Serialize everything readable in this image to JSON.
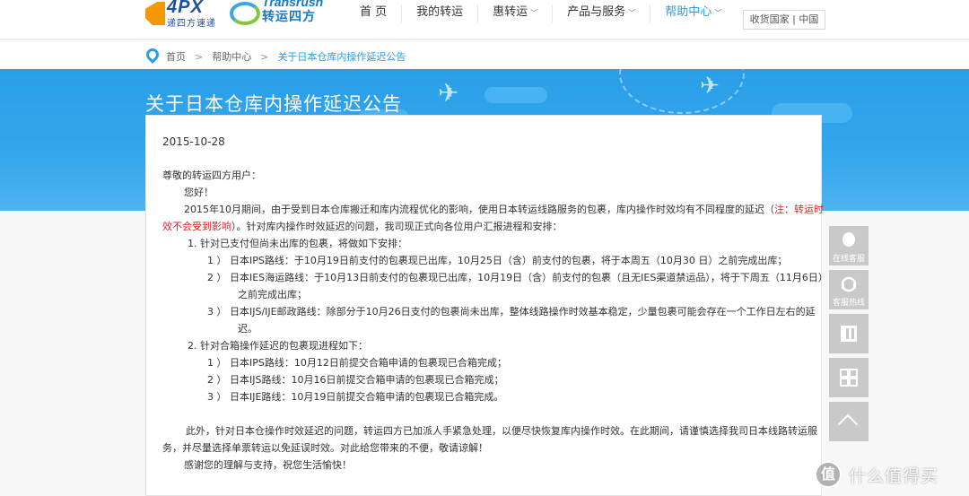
{
  "header": {
    "logo_4px_text": "4PX",
    "logo_4px_sub": "递四方速递",
    "logo_tk_en": "Transrush",
    "logo_tk_cn": "转运四方",
    "nav": [
      {
        "label": "首 页",
        "caret": ""
      },
      {
        "label": "我的转运",
        "caret": ""
      },
      {
        "label": "惠转运",
        "caret": "﹀"
      },
      {
        "label": "产品与服务",
        "caret": "﹀"
      },
      {
        "label": "帮助中心",
        "caret": "﹀"
      }
    ],
    "region": "收货国家 | 中国"
  },
  "breadcrumb": {
    "home": "首页",
    "help": "帮助中心",
    "current": "关于日本仓库内操作延迟公告",
    "separator": ">"
  },
  "banner": {
    "title": "关于日本仓库内操作延迟公告"
  },
  "article": {
    "date": "2015-10-28",
    "greeting": "尊敬的转运四方用户：",
    "hello": "您好！",
    "intro_1a": "2015年10月期间，由于受到日本仓库搬迁和库内流程优化的影响，使用日本转运线路服务的包裹，库内操作时效均有不同程度的延迟（",
    "intro_1b": "注：转运时",
    "intro_2a": "效不会受到影响",
    "intro_2b": "）。针对库内操作时效延迟的问题，我司现正式向各位用户汇报进程和安排：",
    "s1_title": "1.  针对已支付但尚未出库的包裹，将做如下安排：",
    "s1_1": "1 ）  日本IPS路线：于10月19日前支付的包裹现已出库，10月25日（含）前支付的包裹，将于本周五（10月30 日）之前完成出库；",
    "s1_2a": "2 ）  日本IES海运路线：于10月13日前支付的包裹现已出库，10月19日（含）前支付的包裹（且无IES渠道禁运品），将于下周五（11月6日）",
    "s1_2b": "之前完成出库；",
    "s1_3a": "3 ）  日本IJS/IJE邮政路线：除部分于10月26日支付的包裹尚未出库，整体线路操作时效基本稳定，少量包裹可能会存在一个工作日左右的延",
    "s1_3b": "迟。",
    "s2_title": "2.  针对合箱操作延迟的包裹现进程如下：",
    "s2_1": "1 ）  日本IPS路线：10月12日前提交合箱申请的包裹现已合箱完成；",
    "s2_2": "2 ）  日本IJS路线：10月16日前提交合箱申请的包裹现已合箱完成；",
    "s2_3": "3 ）  日本IJE路线：10月19日前提交合箱申请的包裹现已合箱完成。",
    "outro_1": "此外，针对日本仓操作时效延迟的问题，转运四方已加派人手紧急处理，以便尽快恢复库内操作时效。在此期间，请谨慎选择我司日本线路转运服",
    "outro_2": "务，并尽量选择单票转运以免延误时效。对此给您带来的不便，敬请谅解！",
    "thanks": "感谢您的理解与支持，祝您生活愉快！"
  },
  "tools": {
    "online_service": "在线客服",
    "hotline": "客服热线"
  },
  "watermark": {
    "badge": "值",
    "text": "什么值得买"
  },
  "colors": {
    "brand_blue": "#2a9ee8",
    "warning_red": "#d9232c"
  }
}
